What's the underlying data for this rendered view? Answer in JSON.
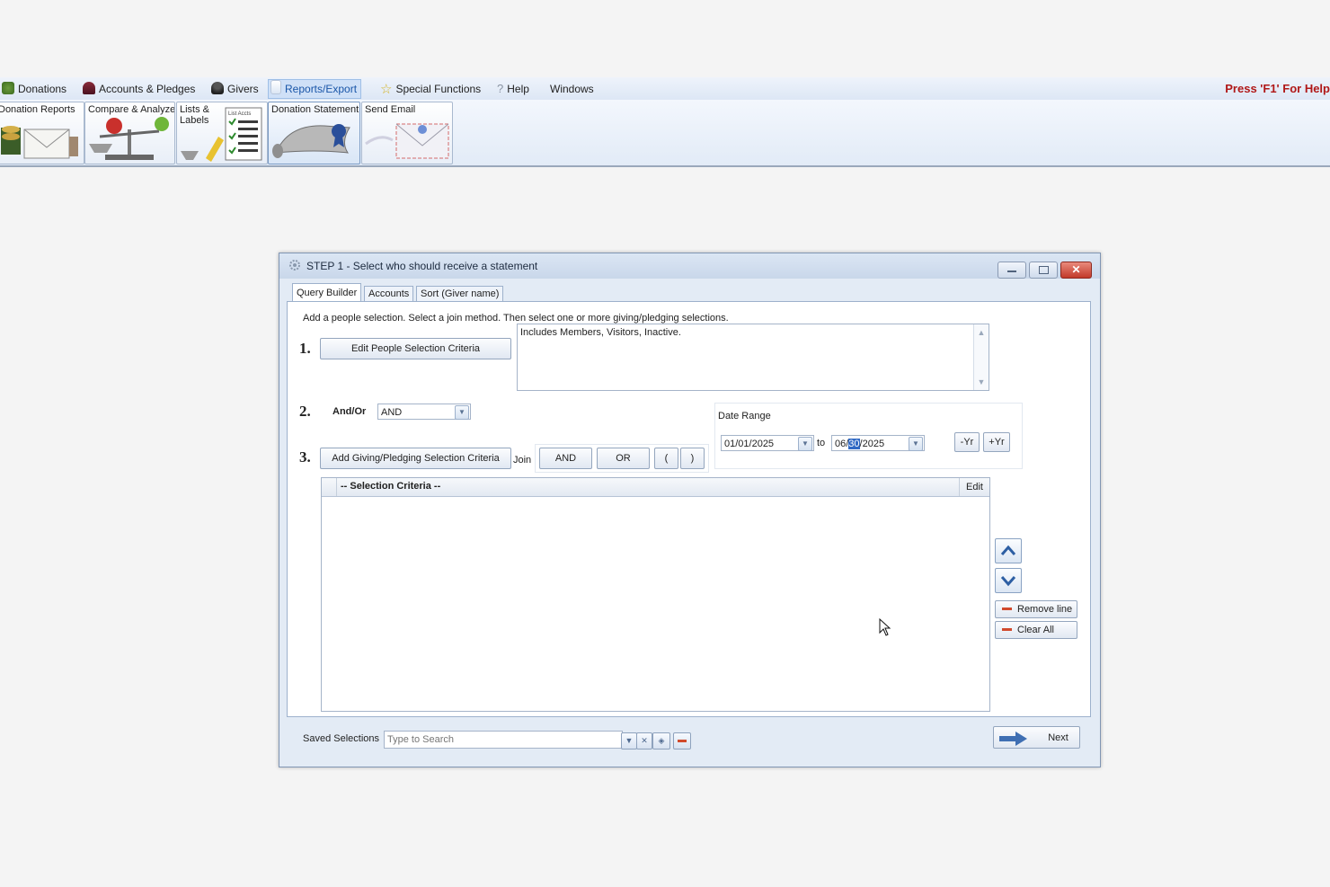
{
  "menu": {
    "items": [
      "Donations",
      "Accounts & Pledges",
      "Givers",
      "Reports/Export",
      "Special Functions",
      "Help",
      "Windows"
    ],
    "active": "Reports/Export",
    "help_hint": "Press 'F1' For Help"
  },
  "toolbar": {
    "buttons": [
      "Donation Reports",
      "Compare & Analyze",
      "Lists &\nLabels",
      "Donation Statement",
      "Send Email"
    ],
    "selected": "Donation Statement",
    "list_acct_tag": "List Accts"
  },
  "dialog": {
    "title": "STEP 1 - Select who should receive a statement",
    "tabs": [
      "Query Builder",
      "Accounts",
      "Sort (Giver name)"
    ],
    "active_tab": "Query Builder",
    "instructions": "Add a people selection.  Select a join method.  Then select one or more giving/pledging selections.",
    "steps": [
      "1.",
      "2.",
      "3."
    ],
    "edit_people_button": "Edit People Selection Criteria",
    "people_summary": "Includes Members, Visitors, Inactive.",
    "andor_label": "And/Or",
    "andor_value": "AND",
    "date_range": {
      "title": "Date Range",
      "from": "01/01/2025",
      "to_label": "to",
      "to_prefix": "06/",
      "to_selected": "30",
      "to_suffix": "/2025",
      "minus_year": "-Yr",
      "plus_year": "+Yr"
    },
    "add_giving_button": "Add Giving/Pledging Selection Criteria",
    "join_label": "Join",
    "join_buttons": [
      "AND",
      "OR",
      "(",
      ")"
    ],
    "grid": {
      "header": "-- Selection Criteria --",
      "edit": "Edit",
      "rows": []
    },
    "remove_line": "Remove line",
    "clear_all": "Clear All",
    "saved_selections_label": "Saved Selections",
    "saved_search_placeholder": "Type to Search",
    "next": "Next"
  },
  "colors": {
    "accent": "#316ac5",
    "help_red": "#b01818",
    "remove_red": "#d14a2c"
  }
}
